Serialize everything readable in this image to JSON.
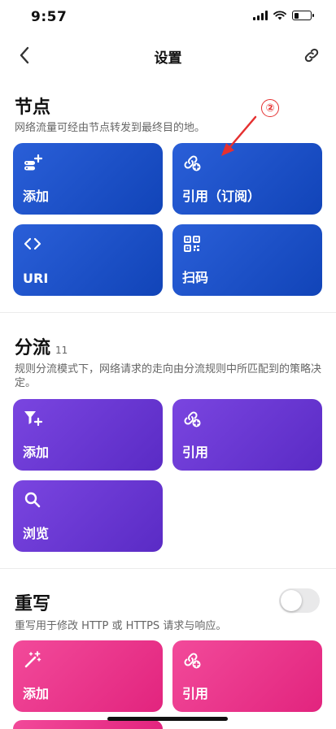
{
  "status": {
    "time": "9:57"
  },
  "nav": {
    "title": "设置"
  },
  "nodes": {
    "title": "节点",
    "desc": "网络流量可经由节点转发到最终目的地。",
    "cards": {
      "add": "添加",
      "ref": "引用（订阅）",
      "uri": "URI",
      "scan": "扫码"
    }
  },
  "split": {
    "title": "分流",
    "count": "11",
    "desc": "规则分流模式下，网络请求的走向由分流规则中所匹配到的策略决定。",
    "cards": {
      "add": "添加",
      "ref": "引用",
      "browse": "浏览"
    }
  },
  "rewrite": {
    "title": "重写",
    "desc": "重写用于修改 HTTP 或 HTTPS 请求与响应。",
    "cards": {
      "add": "添加",
      "ref": "引用"
    },
    "toggle_on": false
  },
  "annotation": {
    "marker": "②"
  },
  "colors": {
    "blue": "#1e50c8",
    "purple": "#6a38d4",
    "pink": "#ec3b8c",
    "annotation": "#e53030"
  }
}
